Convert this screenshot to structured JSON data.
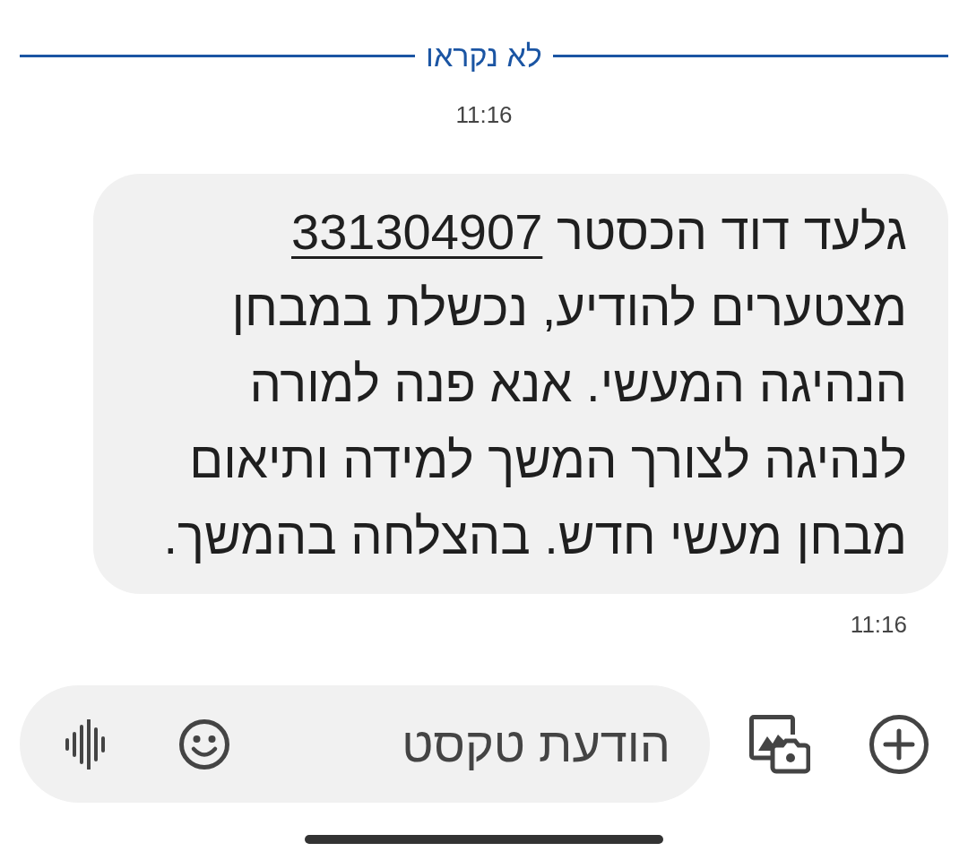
{
  "unread_divider": {
    "label": "לא נקראו"
  },
  "timestamp": "11:16",
  "messages": [
    {
      "parts": [
        {
          "kind": "text",
          "text": "גלעד דוד הכסטר"
        },
        {
          "kind": "link",
          "text": "331304907"
        },
        {
          "kind": "text",
          "text": "מצטערים להודיע, נכשלת במבחן הנהיגה המעשי. אנא פנה למורה לנהיגה לצורך המשך למידה ותיאום מבחן מעשי חדש. בהצלחה בהמשך."
        }
      ],
      "time": "11:16"
    }
  ],
  "composer": {
    "placeholder": "הודעת טקסט"
  }
}
